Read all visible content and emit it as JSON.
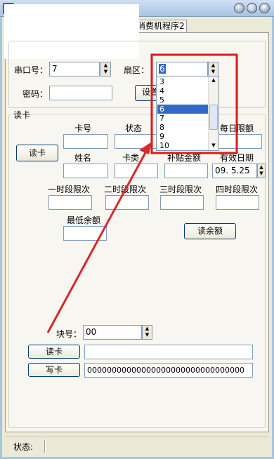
{
  "window": {
    "title": "",
    "tab": "消费机程序2",
    "minimize_glyph": "–",
    "restore_glyph": "○",
    "close_glyph": "✕"
  },
  "top": {
    "port_label": "串口号：",
    "port_value": "7",
    "sector_label": "扇区：",
    "sector_value": "6",
    "password_label": "密码：",
    "password_value": "",
    "set_button": "设置",
    "sector_options": [
      "3",
      "4",
      "5",
      "6",
      "7",
      "8",
      "9",
      "10"
    ],
    "sector_selected": "6"
  },
  "read_group": {
    "legend": "读卡",
    "read_card_button": "读卡",
    "card_no_label": "卡号",
    "status_label": "状态",
    "daily_limit_label": "每日限额",
    "name_label": "姓名",
    "card_type_label": "卡类",
    "subsidy_label": "补贴金额",
    "expiry_label": "有效日期",
    "expiry_value": "09. 5.25",
    "period1_label": "一时段限次",
    "period2_label": "二时段限次",
    "period3_label": "三时段限次",
    "period4_label": "四时段限次",
    "min_balance_label": "最低余额",
    "read_balance_button": "读余额",
    "block_label": "块号：",
    "block_value": "00",
    "read_button": "读卡",
    "write_button": "写卡",
    "read_value": "",
    "write_value": "00000000000000000000000000000000"
  },
  "status": {
    "label": "状态:",
    "value": ""
  },
  "annotation": {
    "box_color": "#e01818",
    "arrow_color": "#d42a2a"
  }
}
